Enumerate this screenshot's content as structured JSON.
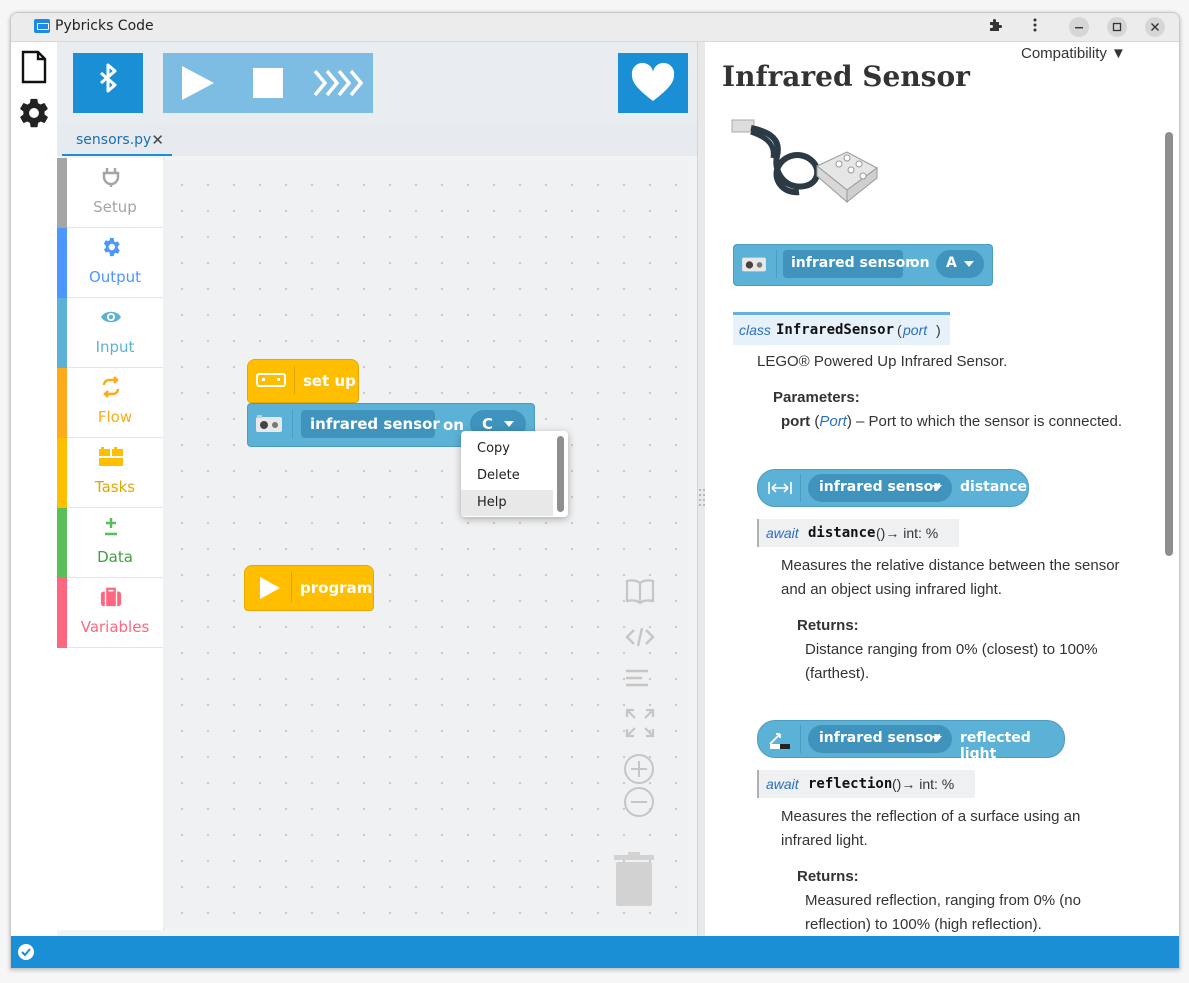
{
  "window": {
    "title": "Pybricks Code"
  },
  "toolbar": {
    "buttons": [
      "bluetooth",
      "run",
      "stop",
      "repl",
      "sponsor"
    ]
  },
  "tab": {
    "filename": "sensors.py",
    "close_glyph": "✕"
  },
  "categories": [
    {
      "label": "Setup",
      "color": "#a5a5a5",
      "icon": "plug-icon"
    },
    {
      "label": "Output",
      "color": "#4c97ff",
      "icon": "gear-icon"
    },
    {
      "label": "Input",
      "color": "#5cb1d6",
      "icon": "eye-icon"
    },
    {
      "label": "Flow",
      "color": "#ffab19",
      "icon": "loop-icon"
    },
    {
      "label": "Tasks",
      "color": "#ffbf00",
      "icon": "bricks-icon"
    },
    {
      "label": "Data",
      "color": "#59c059",
      "icon": "plus-minus-icon"
    },
    {
      "label": "Variables",
      "color": "#ff6680",
      "icon": "suitcase-icon"
    }
  ],
  "blocks": {
    "setup_label": "set up",
    "sensor_label": "infrared sensor",
    "on_label": "on",
    "port_value": "C",
    "program_label": "program"
  },
  "context_menu": {
    "items": [
      "Copy",
      "Delete",
      "Help"
    ]
  },
  "docs": {
    "heading": "Infrared Sensor",
    "compat_label": "Compatibility ▼",
    "example_block": {
      "label": "infrared sensor",
      "on": "on",
      "port": "A"
    },
    "class_sig": {
      "keyword": "class",
      "name": "InfraredSensor",
      "param": "port"
    },
    "class_desc": "LEGO® Powered Up Infrared Sensor.",
    "params_label": "Parameters:",
    "param_name": "port",
    "param_type": "Port",
    "param_desc": " – Port to which the sensor is connected.",
    "distance": {
      "block_label": "infrared sensor",
      "block_value": "distance",
      "sig_kw": "await",
      "sig_name": "distance",
      "sig_ret": "()→ int: %",
      "desc_1": "Measures the relative distance between the sensor",
      "desc_2": "and an object using infrared light.",
      "returns_label": "Returns:",
      "returns_1": "Distance ranging from 0% (closest) to 100%",
      "returns_2": "(farthest)."
    },
    "reflection": {
      "block_label": "infrared sensor",
      "block_value": "reflected light",
      "sig_kw": "await",
      "sig_name": "reflection",
      "sig_ret": "()→ int: %",
      "desc_1": "Measures the reflection of a surface using an",
      "desc_2": "infrared light.",
      "returns_label": "Returns:",
      "returns_1": "Measured reflection, ranging from 0% (no",
      "returns_2": "reflection) to 100% (high reflection)."
    }
  },
  "colors": {
    "accent": "#1b8fd6",
    "sensor_block": "#5cb1d6",
    "setup_block": "#ffbf00"
  }
}
